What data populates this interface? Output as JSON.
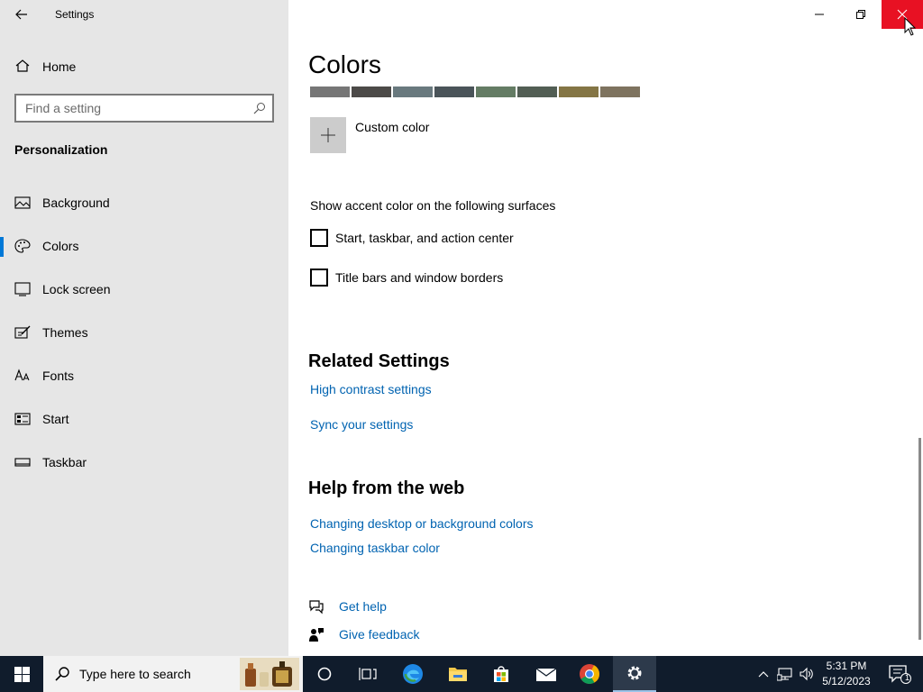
{
  "window": {
    "app_title": "Settings"
  },
  "sidebar": {
    "home_label": "Home",
    "search_placeholder": "Find a setting",
    "section_title": "Personalization",
    "items": [
      {
        "label": "Background",
        "icon": "picture-icon"
      },
      {
        "label": "Colors",
        "icon": "palette-icon",
        "active": true
      },
      {
        "label": "Lock screen",
        "icon": "lock-screen-icon"
      },
      {
        "label": "Themes",
        "icon": "themes-icon"
      },
      {
        "label": "Fonts",
        "icon": "fonts-icon"
      },
      {
        "label": "Start",
        "icon": "start-icon"
      },
      {
        "label": "Taskbar",
        "icon": "taskbar-icon"
      }
    ]
  },
  "main": {
    "title": "Colors",
    "swatches": [
      "#767676",
      "#4c4a48",
      "#69797e",
      "#4a5459",
      "#647c64",
      "#525e54",
      "#847545",
      "#7e735f"
    ],
    "custom_color_label": "Custom color",
    "surfaces_title": "Show accent color on the following surfaces",
    "checkboxes": [
      {
        "label": "Start, taskbar, and action center",
        "checked": false
      },
      {
        "label": "Title bars and window borders",
        "checked": false
      }
    ],
    "related_title": "Related Settings",
    "related_links": [
      "High contrast settings",
      "Sync your settings"
    ],
    "help_title": "Help from the web",
    "help_links": [
      "Changing desktop or background colors",
      "Changing taskbar color"
    ],
    "get_help": "Get help",
    "give_feedback": "Give feedback"
  },
  "taskbar": {
    "search_text": "Type here to search",
    "time": "5:31 PM",
    "date": "5/12/2023",
    "notification_count": "1"
  },
  "colors": {
    "accent": "#0078d7",
    "link": "#0063b1",
    "close_red": "#e81123",
    "taskbar_bg": "#101c2c",
    "sidebar_bg": "#e6e6e6"
  }
}
